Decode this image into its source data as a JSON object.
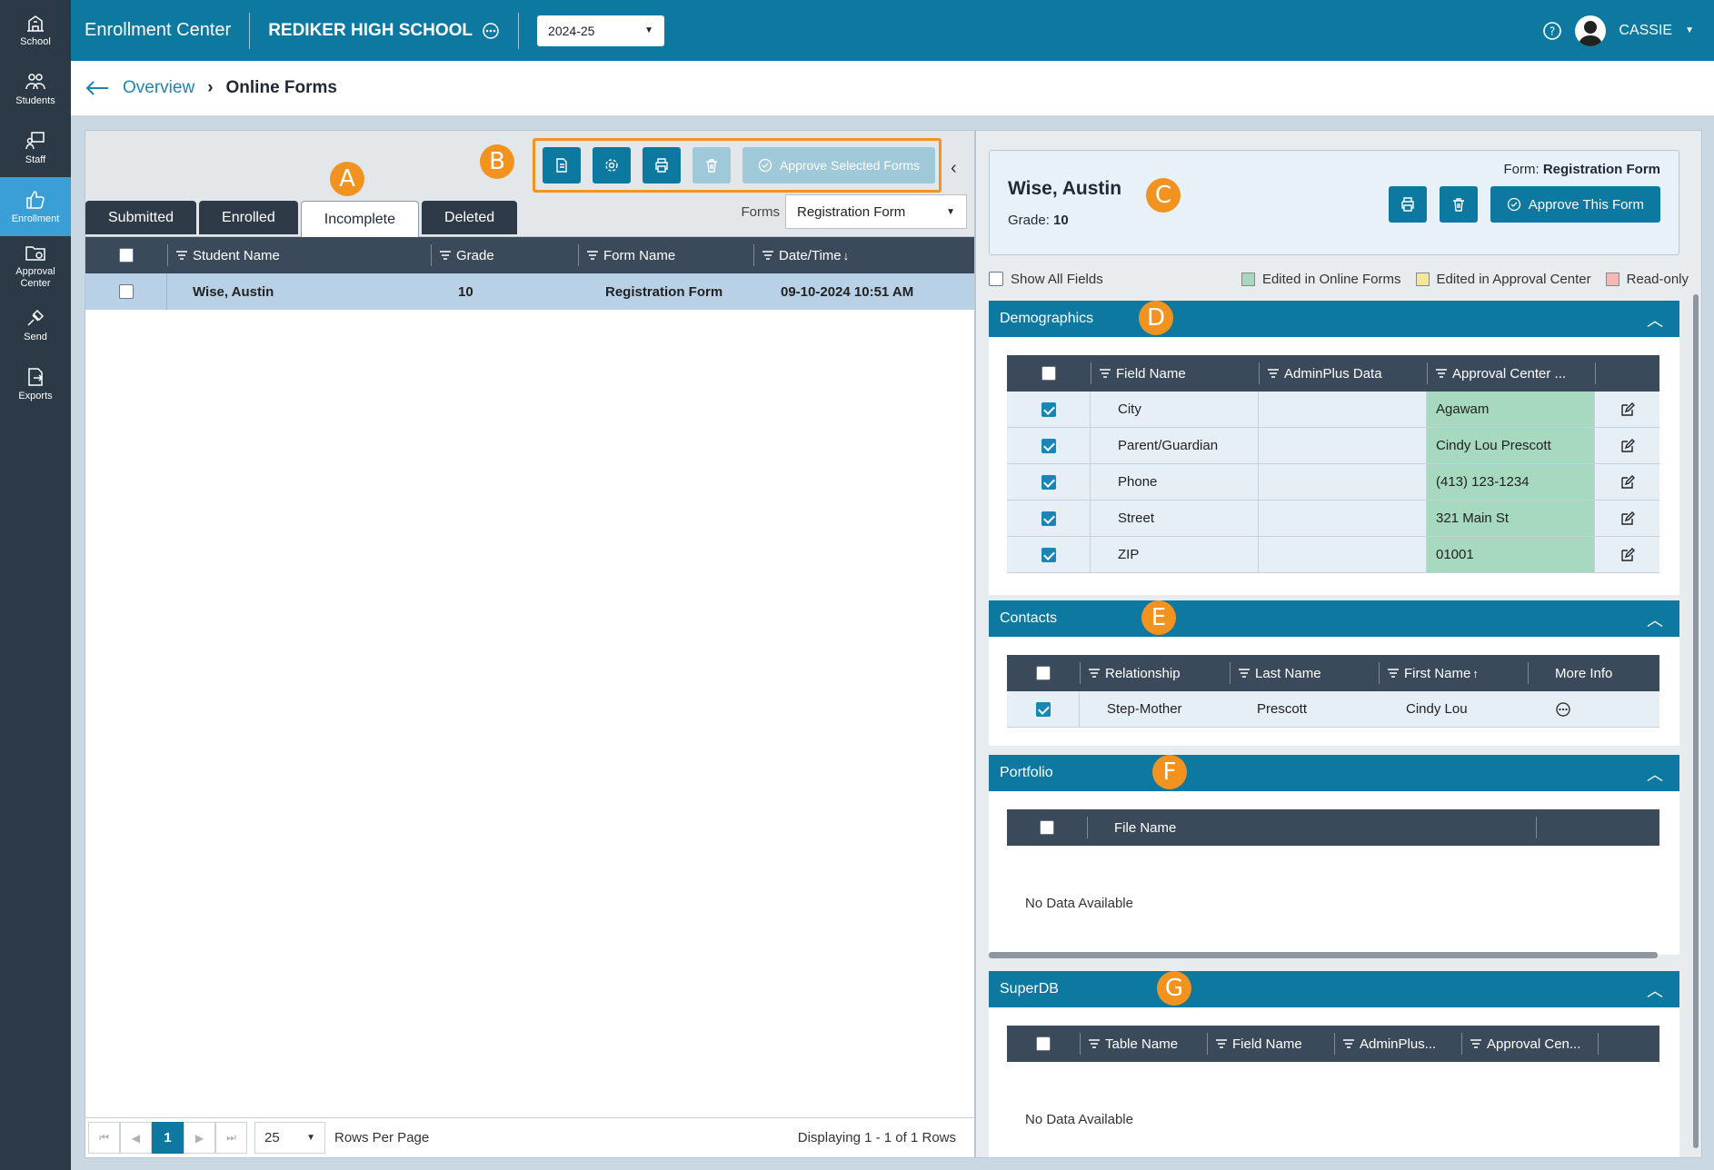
{
  "rail": [
    {
      "label": "School",
      "icon": "school-icon"
    },
    {
      "label": "Students",
      "icon": "students-icon"
    },
    {
      "label": "Staff",
      "icon": "staff-icon"
    },
    {
      "label": "Enrollment",
      "icon": "enrollment-icon"
    },
    {
      "label_line1": "Approval",
      "label_line2": "Center",
      "icon": "approval-center-icon"
    },
    {
      "label": "Send",
      "icon": "send-icon"
    },
    {
      "label": "Exports",
      "icon": "exports-icon"
    }
  ],
  "topbar": {
    "app_title": "Enrollment Center",
    "school_name": "REDIKER HIGH SCHOOL",
    "year": "2024-25",
    "user": "CASSIE"
  },
  "breadcrumb": {
    "parent": "Overview",
    "current": "Online Forms"
  },
  "toolbar": {
    "approve_selected": "Approve Selected Forms"
  },
  "tabs": [
    "Submitted",
    "Enrolled",
    "Incomplete",
    "Deleted"
  ],
  "forms_filter": {
    "label": "Forms",
    "value": "Registration Form"
  },
  "grid": {
    "columns": [
      "Student Name",
      "Grade",
      "Form Name",
      "Date/Time"
    ],
    "rows": [
      {
        "student": "Wise, Austin",
        "grade": "10",
        "form": "Registration Form",
        "datetime": "09-10-2024 10:51 AM"
      }
    ]
  },
  "pager": {
    "page": "1",
    "rows_per_page": "25",
    "rows_label": "Rows Per Page",
    "display": "Displaying 1 - 1 of 1 Rows"
  },
  "student_card": {
    "name": "Wise, Austin",
    "grade_label": "Grade:",
    "grade": "10",
    "form_label": "Form:",
    "form": "Registration Form",
    "approve_label": "Approve This Form"
  },
  "legend": {
    "show_all": "Show All Fields",
    "edited_online": "Edited in Online Forms",
    "edited_approval": "Edited in Approval Center",
    "read_only": "Read-only",
    "colors": {
      "online": "#a7d8c0",
      "approval": "#f3e79a",
      "readonly": "#f3b8b8"
    }
  },
  "demographics": {
    "title": "Demographics",
    "columns": [
      "Field Name",
      "AdminPlus Data",
      "Approval Center ..."
    ],
    "rows": [
      {
        "field": "City",
        "adminplus": "",
        "approval": "Agawam"
      },
      {
        "field": "Parent/Guardian",
        "adminplus": "",
        "approval": "Cindy Lou Prescott"
      },
      {
        "field": "Phone",
        "adminplus": "",
        "approval": "(413) 123-1234"
      },
      {
        "field": "Street",
        "adminplus": "",
        "approval": "321 Main St"
      },
      {
        "field": "ZIP",
        "adminplus": "",
        "approval": "01001"
      }
    ]
  },
  "contacts": {
    "title": "Contacts",
    "columns": [
      "Relationship",
      "Last Name",
      "First Name",
      "More Info"
    ],
    "rows": [
      {
        "relationship": "Step-Mother",
        "last": "Prescott",
        "first": "Cindy Lou"
      }
    ]
  },
  "portfolio": {
    "title": "Portfolio",
    "columns": [
      "File Name"
    ],
    "empty": "No Data Available"
  },
  "superdb": {
    "title": "SuperDB",
    "columns": [
      "Table Name",
      "Field Name",
      "AdminPlus...",
      "Approval Cen..."
    ],
    "empty": "No Data Available"
  },
  "markers": {
    "a": "A",
    "b": "B",
    "c": "C",
    "d": "D",
    "e": "E",
    "f": "F",
    "g": "G"
  },
  "colors": {
    "primary": "#0d79a0",
    "nav": "#2c3947",
    "marker": "#f29320",
    "selected_row": "#b9d1e6"
  }
}
